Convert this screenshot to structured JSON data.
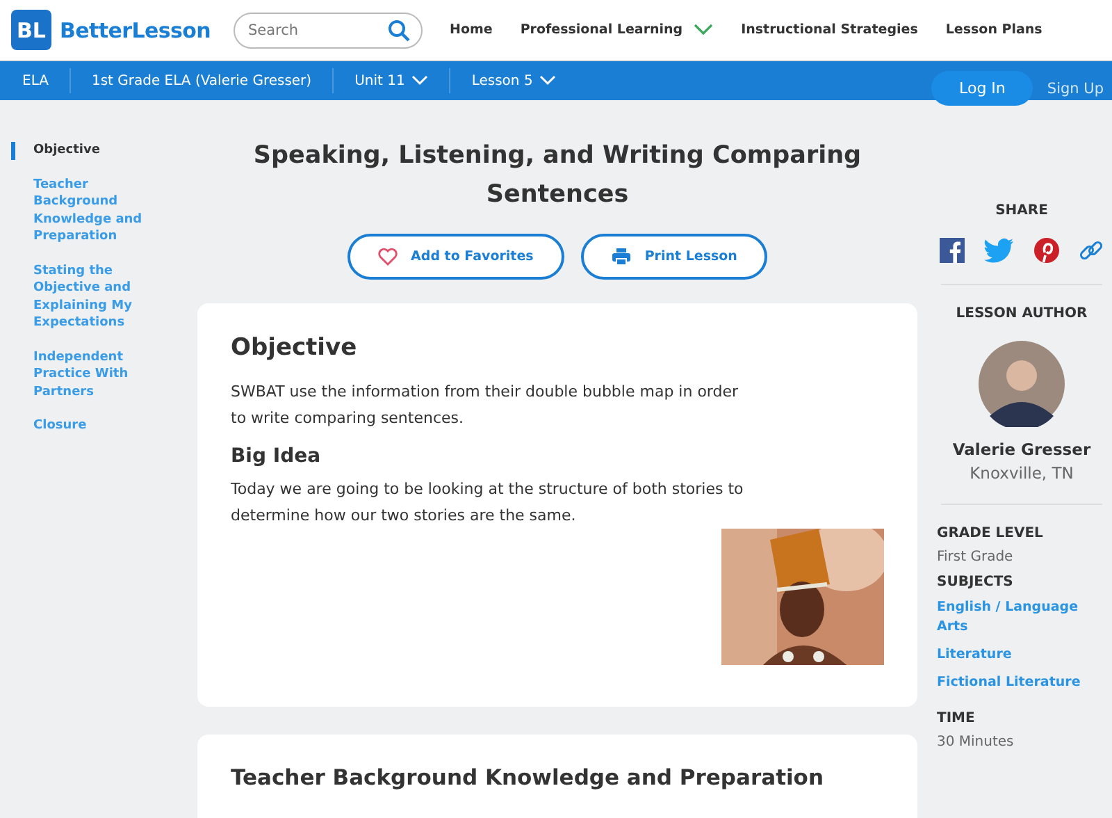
{
  "header": {
    "logo_mark": "BL",
    "logo_text": "BetterLesson",
    "search": {
      "placeholder": "Search"
    },
    "nav": [
      {
        "label": "Home",
        "dropdown": false
      },
      {
        "label": "Professional Learning",
        "dropdown": true
      },
      {
        "label": "Instructional Strategies",
        "dropdown": false
      },
      {
        "label": "Lesson Plans",
        "dropdown": false
      }
    ]
  },
  "breadcrumb": [
    {
      "label": "ELA",
      "dropdown": false
    },
    {
      "label": "1st Grade ELA (Valerie Gresser)",
      "dropdown": false
    },
    {
      "label": "Unit 11",
      "dropdown": true
    },
    {
      "label": "Lesson 5",
      "dropdown": true
    }
  ],
  "auth": {
    "login": "Log In",
    "signup": "Sign Up"
  },
  "sidebar": {
    "items": [
      {
        "label": "Objective",
        "selected": true
      },
      {
        "label": "Teacher Background Knowledge and Preparation",
        "selected": false
      },
      {
        "label": "Stating the Objective and Explaining My Expectations",
        "selected": false
      },
      {
        "label": "Independent Practice With Partners",
        "selected": false
      },
      {
        "label": "Closure",
        "selected": false
      }
    ]
  },
  "lesson": {
    "title": "Speaking, Listening, and Writing Comparing Sentences",
    "buttons": [
      {
        "label": "Add to Favorites",
        "kind": "favorite"
      },
      {
        "label": "Print Lesson",
        "kind": "print"
      }
    ],
    "objective_card": {
      "heading": "Objective",
      "text": "SWBAT use the information from their double bubble map in order to write comparing sentences.",
      "subheading": "Big Idea",
      "big_idea": "Today we are going to be looking at the structure of both stories to determine how our two stories are the same."
    },
    "next_card": {
      "heading": "Teacher Background Knowledge and Preparation"
    }
  },
  "aside": {
    "share_label": "SHARE",
    "share": [
      {
        "kind": "facebook"
      },
      {
        "kind": "twitter"
      },
      {
        "kind": "pinterest"
      },
      {
        "kind": "link"
      }
    ],
    "author_label": "LESSON AUTHOR",
    "author_name": "Valerie Gresser",
    "author_location": "Knoxville, TN",
    "details": [
      {
        "label": "GRADE LEVEL",
        "values": [
          {
            "text": "First Grade",
            "link": false
          }
        ]
      },
      {
        "label": "SUBJECTS",
        "values": [
          {
            "text": "English / Language Arts",
            "link": true
          },
          {
            "text": "Literature",
            "link": true
          },
          {
            "text": "Fictional Literature",
            "link": true
          }
        ]
      },
      {
        "label": "TIME",
        "values": [
          {
            "text": "30 Minutes",
            "link": false
          }
        ]
      }
    ]
  }
}
